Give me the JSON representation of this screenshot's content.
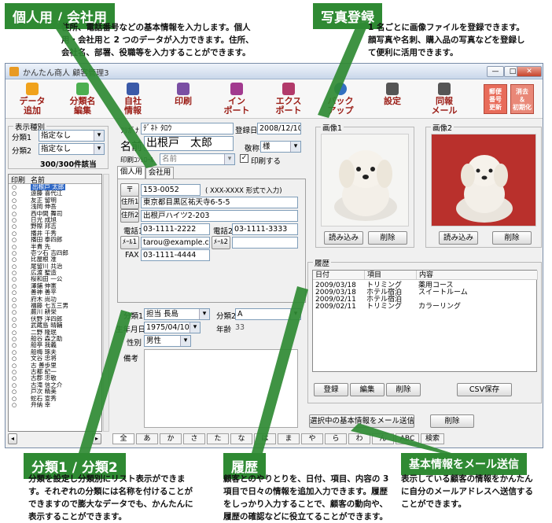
{
  "callouts": {
    "personal": {
      "title": "個人用 / 会社用",
      "text": [
        "住所、電話番号などの基本情報を入力します。個人",
        "用・会社用と 2 つのデータが入力できます。住所、",
        "会社名、部署、役職等を入力することができます。"
      ]
    },
    "photo": {
      "title": "写真登録",
      "text": [
        "1 名ごとに画像ファイルを登録できます。",
        "顔写真や名刺、購入品の写真などを登録し",
        "て便利に活用できます。"
      ]
    },
    "bunrui": {
      "title": "分類1 / 分類2",
      "text": [
        "分類を設定し分類別にリスト表示ができま",
        "す。それぞれの分類には名称を付けることが",
        "できますので膨大なデータでも、かんたんに",
        "表示することができます。"
      ]
    },
    "rireki": {
      "title": "履歴",
      "text": [
        "顧客とのやりとりを、日付、項目、内容の 3",
        "項目で日々の情報を追加入力できます。履歴",
        "をしっかり入力することで、顧客の動向や、",
        "履歴の確認などに役立てることができます。"
      ]
    },
    "mail": {
      "title": "基本情報をメール送信",
      "text": [
        "表示している顧客の情報をかんたん",
        "に自分のメールアドレスへ送信する",
        "ことができます。"
      ]
    }
  },
  "window": {
    "title": "かんたん商人 顧客管理3",
    "minimize": "—",
    "maximize": "□",
    "close": "✕"
  },
  "toolbar": {
    "buttons": [
      {
        "label": "データ\n追加",
        "icon": "add-data-icon",
        "color": "#f0a21c"
      },
      {
        "label": "分類名\n編集",
        "icon": "edit-category-icon",
        "color": "#4caf50"
      },
      {
        "label": "自社\n情報",
        "icon": "company-info-icon",
        "color": "#3b5aa8"
      },
      {
        "label": "印刷",
        "icon": "print-icon",
        "color": "#7a4fa3"
      },
      {
        "label": "イン\nポート",
        "icon": "import-icon",
        "color": "#a23a8f"
      },
      {
        "label": "エクス\nポート",
        "icon": "export-icon",
        "color": "#b23a6a"
      },
      {
        "label": "バック\nアップ",
        "icon": "backup-icon",
        "color": "#3270c0"
      },
      {
        "label": "設定",
        "icon": "settings-icon",
        "color": "#555555"
      },
      {
        "label": "同報\nメール",
        "icon": "mail-icon",
        "color": "#555555"
      }
    ],
    "zip_update": "郵便\n番号\n更新",
    "clear_init": "消去\n＆\n初期化"
  },
  "filter": {
    "group_title": "表示種別",
    "bunrui1_label": "分類1",
    "bunrui1_value": "指定なし",
    "bunrui2_label": "分類2",
    "bunrui2_value": "指定なし",
    "count": "300/300件該当"
  },
  "list": {
    "col_print": "印刷",
    "col_name": "名前",
    "rows": [
      "出根戸 太郎",
      "遠藤 喜代江",
      "友正 留明",
      "浅岡 伸吾",
      "西中間 舞司",
      "日光 成旭",
      "野際 邦吉",
      "播井 千秀",
      "播田 泰四郎",
      "半貴 先",
      "壱ツ石 吉四郎",
      "比屋根 准",
      "尾留川 共治",
      "広渡 聖造",
      "桜和田 一公",
      "澤鋪 伸憲",
      "善神 善平",
      "府木 尚功",
      "福籐 七五三男",
      "蕨川 耕栄",
      "伏野 洋四郎",
      "武蔵島 晴輔",
      "二野 隆珉",
      "船谷 森之助",
      "船亭 我義",
      "船梅 琢夫",
      "文谷 忠将",
      "古 善歩里",
      "古都 紀一",
      "古郡 忠敬",
      "古滝 信之介",
      "戸次 精美",
      "蛇石 宣秀",
      "弁納 幸"
    ]
  },
  "bottom_tabs": [
    "全",
    "あ",
    "か",
    "さ",
    "た",
    "な",
    "は",
    "ま",
    "や",
    "ら",
    "わ",
    "ん",
    "ABC",
    "検索"
  ],
  "detail": {
    "furigana_label": "ﾌﾘｶﾞﾅ",
    "furigana_value": "ﾃﾞﾈﾄ ﾀﾛｳ",
    "reg_label": "登録日",
    "reg_value": "2008/12/10",
    "name_label": "名前",
    "name_value": "出根戸　太郎",
    "keisho_label": "敬称",
    "keisho_value": "様",
    "print_control_label": "印刷ｺﾝﾄﾛｰﾙ",
    "print_control_value": "名前",
    "print_check_label": "印刷する",
    "print_check_mark": "✓",
    "tab_personal": "個人用",
    "tab_company": "会社用",
    "zip_btn": "〒",
    "zip_value": "153-0052",
    "zip_hint": "( XXX-XXXX 形式で入力)",
    "addr1_btn": "住所1",
    "addr1_value": "東京都目黒区祐天寺6-5-5",
    "addr2_btn": "住所2",
    "addr2_value": "出根戸ハイツ2-203",
    "tel1_label": "電話1",
    "tel1_value": "03-1111-2222",
    "tel2_label": "電話2",
    "tel2_value": "03-1111-3333",
    "mail1_btn": "ﾒｰﾙ1",
    "mail1_value": "tarou@example.com",
    "mail2_btn": "ﾒｰﾙ2",
    "mail2_value": "",
    "fax_label": "FAX",
    "fax_value": "03-1111-4444",
    "bunrui1_label": "分類1",
    "bunrui1_value": "担当 長島",
    "bunrui2_label": "分類2",
    "bunrui2_value": "A",
    "birthday_label": "生年月日",
    "birthday_value": "1975/04/10",
    "age_label": "年齢",
    "age_value": "33",
    "gender_label": "性別",
    "gender_value": "男性",
    "memo_label": "備考"
  },
  "images": {
    "img1_title": "画像1",
    "img2_title": "画像2",
    "load_btn": "読み込み",
    "delete_btn": "削除"
  },
  "history": {
    "group_title": "履歴",
    "col_date": "日付",
    "col_item": "項目",
    "col_content": "内容",
    "rows": [
      {
        "date": "2009/03/18",
        "item": "トリミング",
        "content": "薬用コース"
      },
      {
        "date": "2009/03/18",
        "item": "ホテル宿泊",
        "content": "スイートルーム"
      },
      {
        "date": "2009/02/11",
        "item": "ホテル宿泊",
        "content": ""
      },
      {
        "date": "2009/02/11",
        "item": "トリミング",
        "content": "カラーリング"
      }
    ],
    "register_btn": "登録",
    "edit_btn": "編集",
    "delete_btn": "削除",
    "csv_btn": "CSV保存"
  },
  "send_mail_btn": "選択中の基本情報をメール送信",
  "delete_customer_btn": "削除",
  "colors": {
    "callout_green": "#2f8a33",
    "toolbar_label": "#9b1d16",
    "selection": "#3169c6"
  }
}
